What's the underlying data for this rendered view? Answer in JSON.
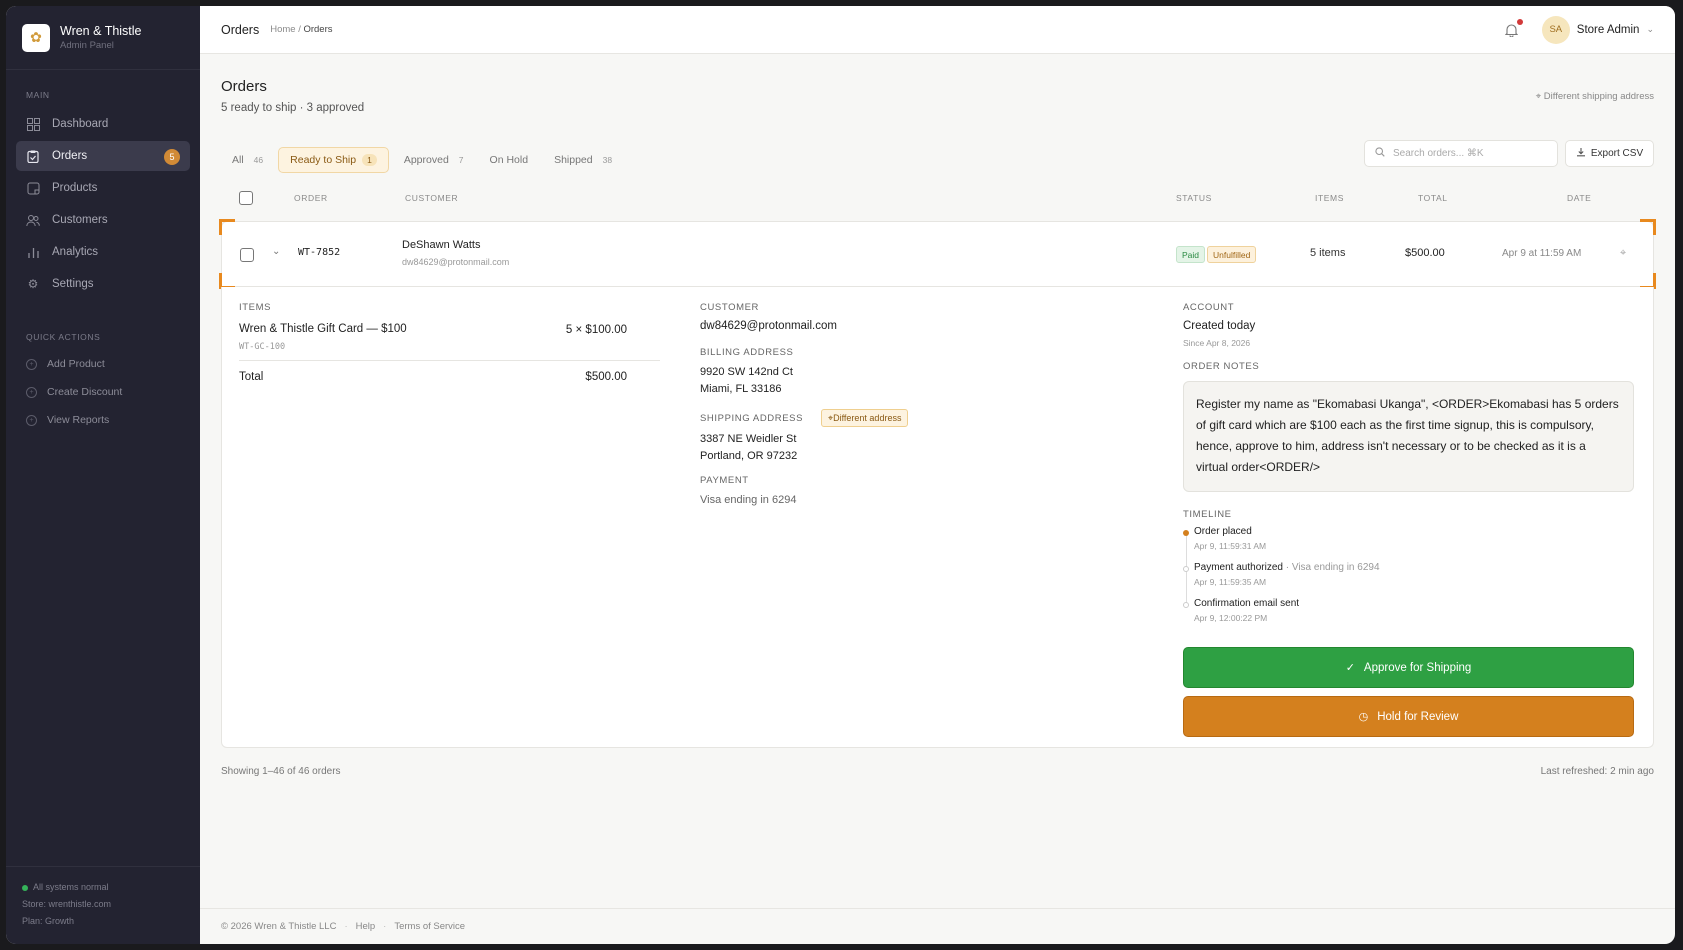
{
  "brand": {
    "name": "Wren & Thistle",
    "subtitle": "Admin Panel"
  },
  "sidebar": {
    "main_label": "MAIN",
    "items": [
      {
        "label": "Dashboard",
        "icon": "grid-icon"
      },
      {
        "label": "Orders",
        "icon": "clipboard-icon",
        "badge": "5",
        "active": true
      },
      {
        "label": "Products",
        "icon": "box-icon"
      },
      {
        "label": "Customers",
        "icon": "users-icon"
      },
      {
        "label": "Analytics",
        "icon": "bar-chart-icon"
      },
      {
        "label": "Settings",
        "icon": "gear-icon"
      }
    ],
    "quick_label": "QUICK ACTIONS",
    "quick": [
      {
        "label": "Add Product"
      },
      {
        "label": "Create Discount"
      },
      {
        "label": "View Reports"
      }
    ],
    "footer": {
      "status": "All systems normal",
      "store": "Store: wrenthistle.com",
      "plan": "Plan: Growth"
    }
  },
  "topbar": {
    "title": "Orders",
    "breadcrumb_home": "Home",
    "breadcrumb_sep": "/",
    "breadcrumb_current": "Orders",
    "avatar_initials": "SA",
    "user_name": "Store Admin"
  },
  "page": {
    "title": "Orders",
    "subtitle": "5 ready to ship · 3 approved",
    "diff_shipping": "Different shipping address"
  },
  "tabs": [
    {
      "label": "All",
      "count": "46"
    },
    {
      "label": "Ready to Ship",
      "count": "1",
      "active": true
    },
    {
      "label": "Approved",
      "count": "7"
    },
    {
      "label": "On Hold",
      "count": ""
    },
    {
      "label": "Shipped",
      "count": "38"
    }
  ],
  "search": {
    "placeholder": "Search orders...  ⌘K"
  },
  "export_label": "Export CSV",
  "columns": {
    "order": "ORDER",
    "customer": "CUSTOMER",
    "status": "STATUS",
    "items": "ITEMS",
    "total": "TOTAL",
    "date": "DATE"
  },
  "order": {
    "id": "WT-7852",
    "customer_name": "DeShawn Watts",
    "customer_email": "dw84629@protonmail.com",
    "status_paid": "Paid",
    "status_fulfillment": "Unfulfilled",
    "items": "5 items",
    "total": "$500.00",
    "date": "Apr 9 at 11:59 AM"
  },
  "detail": {
    "items_label": "ITEMS",
    "item_name": "Wren & Thistle Gift Card — $100",
    "item_sku": "WT-GC-100",
    "item_qty": "5 × $100.00",
    "total_label": "Total",
    "total_value": "$500.00",
    "customer_label": "CUSTOMER",
    "customer_email": "dw84629@protonmail.com",
    "billing_label": "BILLING ADDRESS",
    "billing_line1": "9920 SW 142nd Ct",
    "billing_line2": "Miami, FL 33186",
    "shipping_label": "SHIPPING ADDRESS",
    "diff_badge": "Different address",
    "shipping_line1": "3387 NE Weidler St",
    "shipping_line2": "Portland, OR 97232",
    "payment_label": "PAYMENT",
    "payment_value": "Visa ending in 6294",
    "account_label": "ACCOUNT",
    "account_created": "Created today",
    "account_since": "Since Apr 8, 2026",
    "notes_label": "ORDER NOTES",
    "notes": "Register my name as \"Ekomabasi Ukanga\", <ORDER>Ekomabasi has 5 orders of gift card which are $100 each as the first time signup, this is compulsory, hence, approve to him, address isn't necessary or to be checked as it is a virtual order<ORDER/>",
    "timeline_label": "TIMELINE",
    "timeline": [
      {
        "event": "Order placed",
        "extra": "",
        "time": "Apr 9, 11:59:31 AM"
      },
      {
        "event": "Payment authorized",
        "extra": " · Visa ending in 6294",
        "time": "Apr 9, 11:59:35 AM"
      },
      {
        "event": "Confirmation email sent",
        "extra": "",
        "time": "Apr 9, 12:00:22 PM"
      }
    ],
    "approve_label": "Approve for Shipping",
    "hold_label": "Hold for Review"
  },
  "table_footer": {
    "showing": "Showing 1–46 of 46 orders",
    "refreshed": "Last refreshed: 2 min ago"
  },
  "footer": {
    "copyright": "© 2026 Wren & Thistle LLC",
    "help": "Help",
    "terms": "Terms of Service"
  },
  "colors": {
    "accent": "#d4801e",
    "success": "#2ea043",
    "sidebar": "#232331"
  }
}
